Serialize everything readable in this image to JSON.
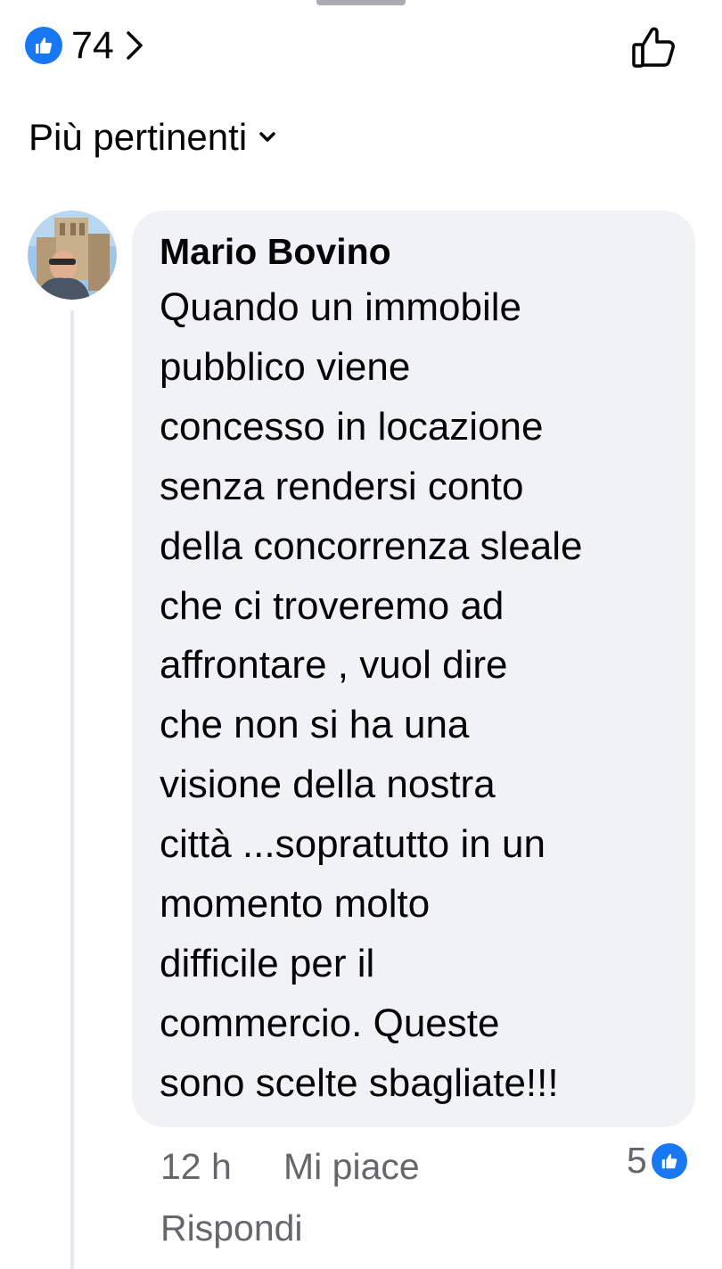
{
  "reactions": {
    "count": "74",
    "icon": "like-icon",
    "color": "#1877f2"
  },
  "sort": {
    "label": "Più pertinenti"
  },
  "comment": {
    "author": "Mario Bovino",
    "lines": [
      "Quando un immobile",
      "pubblico viene",
      "concesso in locazione",
      "senza rendersi conto",
      "della concorrenza sleale",
      "che ci troveremo ad",
      "affrontare , vuol dire",
      "che non si ha una",
      "visione della nostra",
      "città ...sopratutto in un",
      "momento molto",
      "difficile per il",
      "commercio. Queste",
      "sono scelte sbagliate!!!"
    ],
    "time": "12 h",
    "like_label": "Mi piace",
    "reply_label": "Rispondi",
    "reaction_count": "5"
  },
  "colors": {
    "accent": "#1877f2",
    "bubble": "#f0f2f5",
    "secondary_text": "#65676b"
  }
}
